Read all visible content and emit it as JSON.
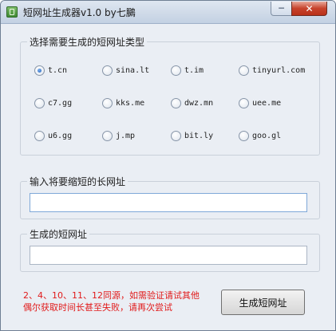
{
  "window": {
    "title": "短网址生成器v1.0   by七鵩",
    "minimize_glyph": "─",
    "close_glyph": "✕"
  },
  "service_group": {
    "label": "选择需要生成的短网址类型",
    "selected": "t.cn",
    "options": [
      "t.cn",
      "sina.lt",
      "t.im",
      "tinyurl.com",
      "c7.gg",
      "kks.me",
      "dwz.mn",
      "uee.me",
      "u6.gg",
      "j.mp",
      "bit.ly",
      "goo.gl"
    ]
  },
  "long_url_group": {
    "label": "输入将要缩短的长网址",
    "value": "",
    "placeholder": ""
  },
  "short_url_group": {
    "label": "生成的短网址",
    "value": "",
    "placeholder": ""
  },
  "note": {
    "line1": "2、4、10、11、12同源，如需验证请试其他",
    "line2": "偶尔获取时间长甚至失败，请再次尝试",
    "color": "#e11a1a"
  },
  "generate_button": {
    "label": "生成短网址"
  }
}
